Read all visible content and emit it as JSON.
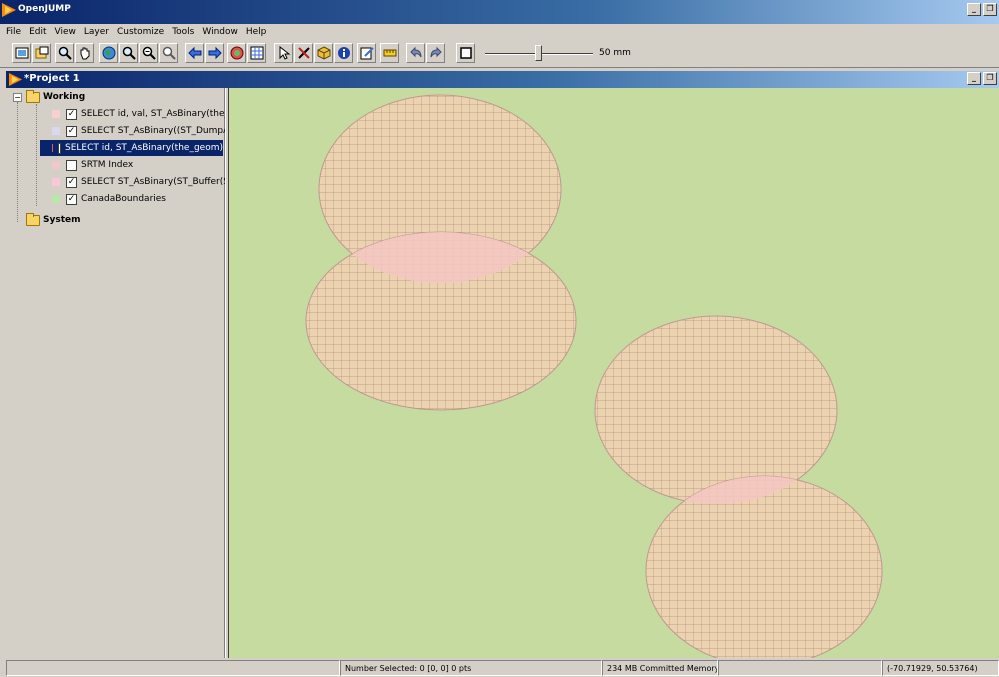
{
  "app": {
    "title": "OpenJUMP",
    "window_buttons": [
      "_",
      "❐"
    ]
  },
  "menu": [
    "File",
    "Edit",
    "View",
    "Layer",
    "Customize",
    "Tools",
    "Window",
    "Help"
  ],
  "toolbar": {
    "icons": [
      "zoom-to-full-extent-icon",
      "zoom-to-layer-icon",
      "zoom-tool-icon",
      "pan-tool-icon",
      "globe-icon",
      "zoom-in-icon",
      "zoom-out-icon",
      "zoom-previous-icon",
      "back-arrow-icon",
      "forward-arrow-icon",
      "layer-view-icon",
      "attribute-table-icon",
      "select-arrow-icon",
      "edit-vertex-icon",
      "cube-icon",
      "info-icon",
      "edit-toggle-icon",
      "measure-icon",
      "undo-icon",
      "redo-icon",
      "frame-icon"
    ],
    "scale_label": "50 mm"
  },
  "project": {
    "title": "*Project  1"
  },
  "tree": {
    "working_label": "Working",
    "system_label": "System",
    "layers": [
      {
        "label": "SELECT id, val, ST_AsBinary(the_geo",
        "checked": true,
        "swatch": "#f7d0d0"
      },
      {
        "label": "SELECT ST_AsBinary((ST_DumpAsPol",
        "checked": true,
        "swatch": "#d8d8f0"
      },
      {
        "label": "SELECT id, ST_AsBinary(the_geom)",
        "checked": false,
        "swatch": "#e05a5a",
        "selected": true
      },
      {
        "label": "SRTM Index",
        "checked": false,
        "swatch": "#f0c8c8"
      },
      {
        "label": "SELECT ST_AsBinary(ST_Buffer(ST_L",
        "checked": true,
        "swatch": "#f8c8d8"
      },
      {
        "label": "CanadaBoundaries",
        "checked": true,
        "swatch": "#b8e8a8"
      }
    ]
  },
  "map": {
    "background": "#c5dba0",
    "raster_fill": "#ecd3b0",
    "grid_line": "#b48c82",
    "overlap_fill": "#f5c5c2"
  },
  "status": {
    "selected": "Number Selected: 0 [0, 0] 0 pts",
    "memory": "234 MB Committed Memory",
    "coords": "(-70.71929, 50.53764)"
  }
}
